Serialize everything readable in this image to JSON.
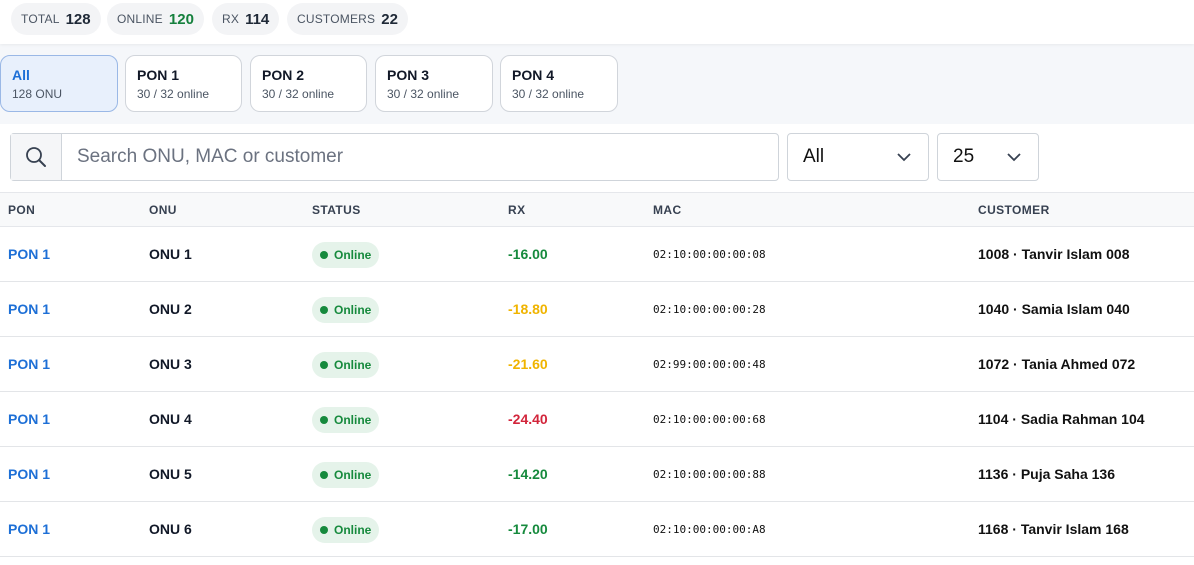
{
  "stats": [
    {
      "label": "TOTAL",
      "value": "128"
    },
    {
      "label": "ONLINE",
      "value": "120"
    },
    {
      "label": "RX",
      "value": "114"
    },
    {
      "label": "CUSTOMERS",
      "value": "22"
    }
  ],
  "tabs": [
    {
      "label": "All",
      "sub": "128 ONU",
      "active": true
    },
    {
      "label": "PON 1",
      "sub": "30 / 32 online"
    },
    {
      "label": "PON 2",
      "sub": "30 / 32 online"
    },
    {
      "label": "PON 3",
      "sub": "30 / 32 online"
    },
    {
      "label": "PON 4",
      "sub": "30 / 32 online"
    }
  ],
  "search": {
    "placeholder": "Search ONU, MAC or customer",
    "value": ""
  },
  "filters": {
    "status_value": "All",
    "page_size_value": "25"
  },
  "table": {
    "headers": {
      "pon": "PON",
      "onu": "ONU",
      "status": "STATUS",
      "rx": "RX",
      "mac": "MAC",
      "customer": "CUSTOMER"
    },
    "rows": [
      {
        "pon": "PON 1",
        "onu": "ONU 1",
        "status": "Online",
        "rx": "-16.00",
        "rx_level": "green",
        "mac": "02:10:00:00:00:08",
        "customer": "1008 · Tanvir Islam 008"
      },
      {
        "pon": "PON 1",
        "onu": "ONU 2",
        "status": "Online",
        "rx": "-18.80",
        "rx_level": "amber",
        "mac": "02:10:00:00:00:28",
        "customer": "1040 · Samia Islam 040"
      },
      {
        "pon": "PON 1",
        "onu": "ONU 3",
        "status": "Online",
        "rx": "-21.60",
        "rx_level": "amber",
        "mac": "02:99:00:00:00:48",
        "customer": "1072 · Tania Ahmed 072"
      },
      {
        "pon": "PON 1",
        "onu": "ONU 4",
        "status": "Online",
        "rx": "-24.40",
        "rx_level": "red",
        "mac": "02:10:00:00:00:68",
        "customer": "1104 · Sadia Rahman 104"
      },
      {
        "pon": "PON 1",
        "onu": "ONU 5",
        "status": "Online",
        "rx": "-14.20",
        "rx_level": "green",
        "mac": "02:10:00:00:00:88",
        "customer": "1136 · Puja Saha 136"
      },
      {
        "pon": "PON 1",
        "onu": "ONU 6",
        "status": "Online",
        "rx": "-17.00",
        "rx_level": "green",
        "mac": "02:10:00:00:00:A8",
        "customer": "1168 · Tanvir Islam 168"
      }
    ]
  },
  "colors": {
    "accent": "#1d6fd6",
    "online": "#168a3d",
    "rx_green": "#168a3d",
    "rx_amber": "#f0b400",
    "rx_red": "#d2253b"
  },
  "icons": {
    "search": "search-icon",
    "dropdown": "chevron-down-icon",
    "status_dot": "status-dot-icon"
  }
}
